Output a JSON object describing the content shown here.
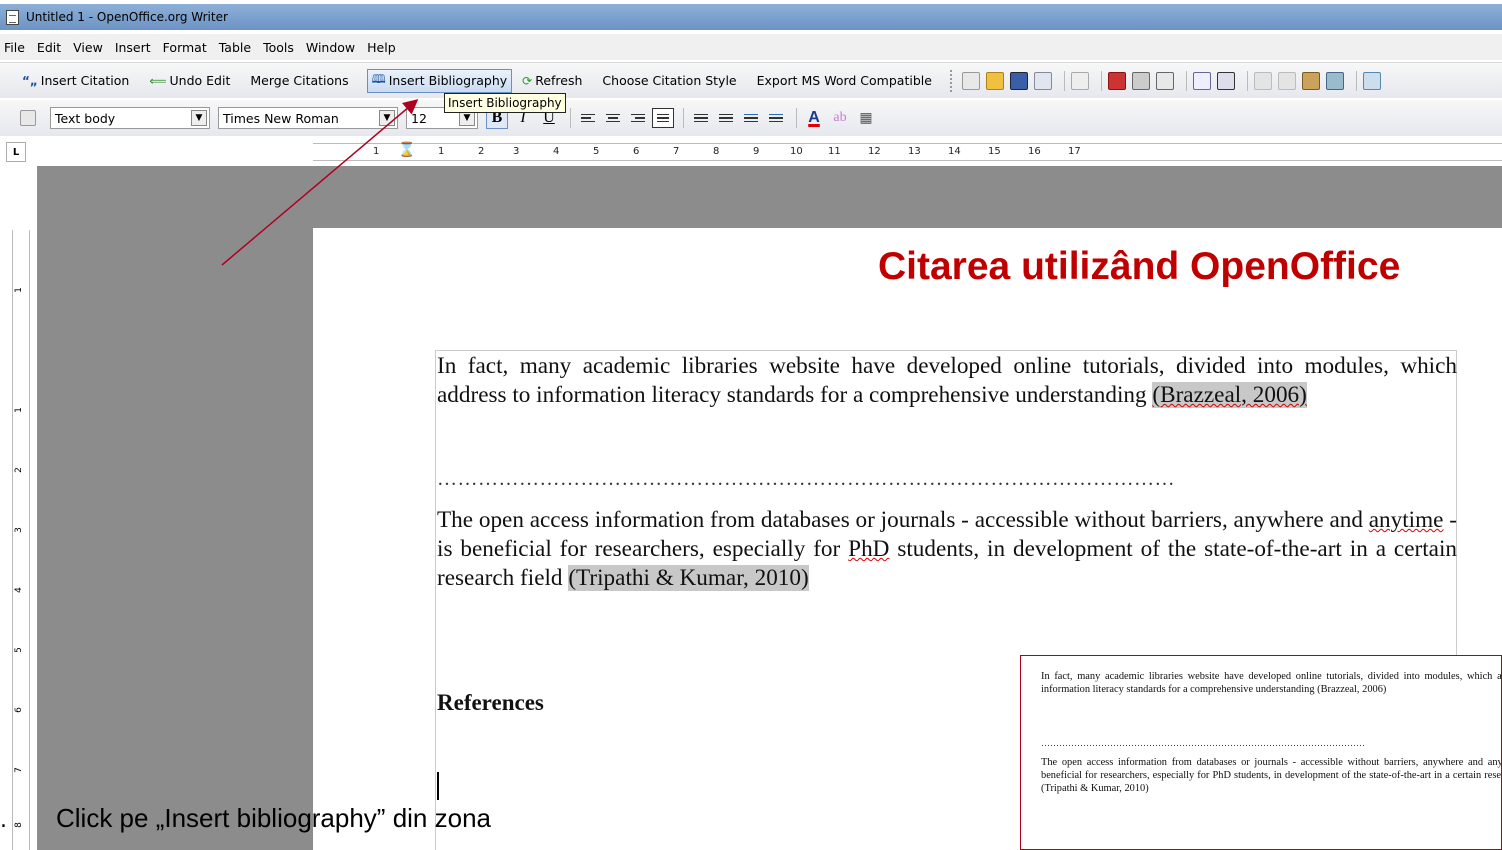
{
  "window": {
    "title": "Untitled 1 - OpenOffice.org Writer"
  },
  "menu": [
    "File",
    "Edit",
    "View",
    "Insert",
    "Format",
    "Table",
    "Tools",
    "Window",
    "Help"
  ],
  "citation_toolbar": {
    "insert_citation": "Insert Citation",
    "undo_edit": "Undo Edit",
    "merge_citations": "Merge Citations",
    "insert_bibliography": "Insert Bibliography",
    "refresh": "Refresh",
    "choose_style": "Choose Citation Style",
    "export_ms_word": "Export MS Word Compatible"
  },
  "format_toolbar": {
    "paragraph_style": "Text body",
    "font_name": "Times New Roman",
    "font_size": "12"
  },
  "tooltip": "Insert Bibliography",
  "ruler": {
    "marks": [
      "1",
      "1",
      "2",
      "3",
      "4",
      "5",
      "6",
      "7",
      "8",
      "9",
      "10",
      "11",
      "12",
      "13",
      "14",
      "15",
      "16",
      "17"
    ],
    "vertical_marks": [
      "1",
      "1",
      "2",
      "3",
      "4",
      "5",
      "6",
      "7",
      "8"
    ]
  },
  "document": {
    "heading": "Citarea utilizând OpenOffice",
    "para1_text": "In fact, many academic libraries website have developed online tutorials, divided into modules, which address to information literacy standards for a comprehensive understanding ",
    "para1_citation": "(Brazzeal, 2006)",
    "dots": "………………………………………………………………………………………………",
    "para2_a": "The open access information from databases or journals - accessible without barriers, anywhere and ",
    "para2_anytime": "anytime",
    "para2_b": " - is beneficial for researchers, especially for ",
    "para2_phd": "PhD",
    "para2_c": " students, in development of the state-of-the-art in a certain research field ",
    "para2_citation": "(Tripathi & Kumar, 2010)",
    "references": "References"
  },
  "inset": {
    "para1": "In fact, many academic libraries website have developed online tutorials, divided into modules, which address to information literacy standards for a comprehensive understanding (Brazzeal, 2006)",
    "para2": "The open access information from databases or journals - accessible without barriers, anywhere and anytime - is beneficial for researchers, especially for PhD students, in development of the state-of-the-art in a certain research field (Tripathi & Kumar, 2010)"
  },
  "caption": "Click pe „Insert bibliography” din zona",
  "colors": {
    "heading": "#c00000",
    "arrow": "#b00020",
    "citation_bg": "#c8c8c8"
  }
}
